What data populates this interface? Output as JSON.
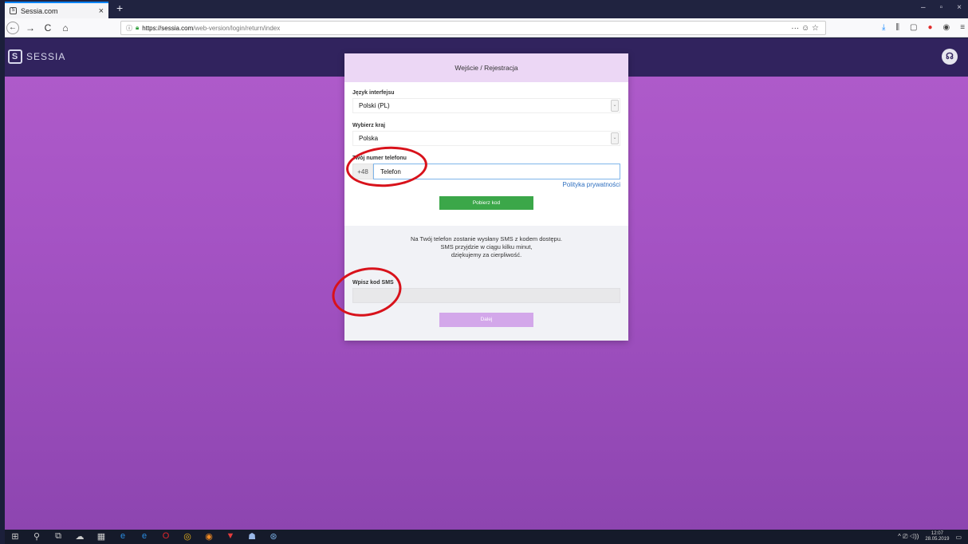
{
  "browser": {
    "tab_title": "Sessia.com",
    "tab_favicon": "S",
    "tab_close": "×",
    "new_tab": "+",
    "window_controls": [
      "–",
      "▫",
      "×"
    ],
    "url_host": "https://sessia.com",
    "url_path": "/web-version/login/return/index",
    "nav_back": "←",
    "nav_forward": "→",
    "nav_reload": "C",
    "nav_home": "⌂",
    "page_actions": "··· ☺ ☆",
    "toolbar_icons": [
      "⤓",
      "⫼",
      "▢",
      "ABP",
      "◉",
      "≡"
    ]
  },
  "site": {
    "logo_mark": "S",
    "logo_text": "SESSIA",
    "support_icon": "☊"
  },
  "modal": {
    "title": "Wejście / Rejestracja",
    "language_label": "Język interfejsu",
    "language_value": "Polski (PL)",
    "country_label": "Wybierz kraj",
    "country_value": "Polska",
    "phone_label": "Twój numer telefonu",
    "phone_prefix": "+48",
    "phone_value": "Telefon",
    "privacy_link": "Polityka prywatności",
    "get_code_button": "Pobierz kod",
    "sms_info_line1": "Na Twój telefon zostanie wysłany SMS z kodem dostępu.",
    "sms_info_line2": "SMS przyjdzie w ciągu kilku minut,",
    "sms_info_line3": "dziękujemy za cierpliwość.",
    "sms_code_label": "Wpisz kod SMS",
    "sms_code_value": "",
    "next_button": "Dalej",
    "select_chevron": "⌄"
  },
  "taskbar": {
    "icons": [
      "⊞",
      "⚲",
      "⧉",
      "☁",
      "▦",
      "e",
      "e",
      "O",
      "◎",
      "◉",
      "▼",
      "☗",
      "⊛"
    ],
    "tray": "^ ⎚ ◁))",
    "time": "12:07",
    "date": "28.05.2019",
    "notifications": "▭"
  }
}
